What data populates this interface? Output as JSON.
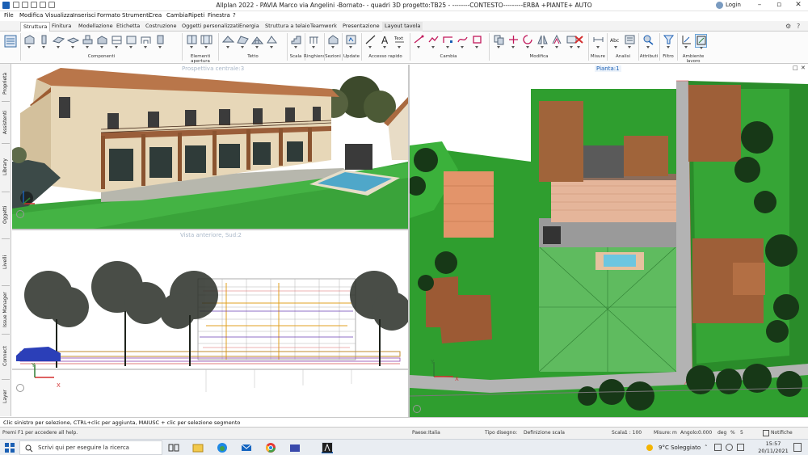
{
  "window": {
    "title": "Allplan 2022 - PAVIA Marco via Angelini -Bornato- - quadri 3D progetto:TB25 - --------CONTESTO---------ERBA +PIANTE+ AUTO",
    "login": "Login"
  },
  "menu": [
    "File",
    "Modifica",
    "Visualizza",
    "Inserisci",
    "Formato",
    "Strumenti",
    "Crea",
    "Cambia",
    "Ripeti",
    "Finestra",
    "?"
  ],
  "tabs": [
    "Struttura",
    "Finitura",
    "Modellazione",
    "Etichetta",
    "Costruzione",
    "Oggetti personalizzati",
    "Energia",
    "Struttura a telaio",
    "Teamwork",
    "Presentazione",
    "Layout tavola"
  ],
  "active_tab": "Struttura",
  "ribbon_groups": [
    "Componenti",
    "Elementi apertura",
    "Tetto",
    "Scala",
    "Ringhiera",
    "Sezioni",
    "Update",
    "Accesso rapido",
    "Cambia",
    "Modifica",
    "Misure",
    "Analisi",
    "Attributi",
    "Filtro",
    "Ambiente lavoro"
  ],
  "ribbon_labels": {
    "accesso_rapido_a": "A",
    "accesso_rapido_text": "Text",
    "analisi_abc": "Abc"
  },
  "side_tabs": [
    "Proprietà",
    "Assistenti",
    "Library",
    "Oggetti",
    "Livelli",
    "Issue Manager",
    "Connect",
    "Layer"
  ],
  "viewports": {
    "perspective_title": "Prospettiva centrale:3",
    "front_title": "Vista anteriore, Sud:2",
    "plan_title": "Pianta:1",
    "axis_x": "X",
    "axis_y": "Y",
    "axis_z": "Z"
  },
  "status": {
    "hint": "Clic sinistro per selezione, CTRL+clic per aggiunta, MAIUSC + clic per selezione segmento",
    "help": "Premi F1 per accedere all help.",
    "paese_label": "Paese:",
    "paese_value": "Italia",
    "tipo_label": "Tipo disegno:",
    "tipo_value": "Definizione scala",
    "scala_label": "Scala:",
    "scala_value": "1 : 100",
    "misure_label": "Misure:",
    "misure_value": "m",
    "angolo_label": "Angolo:",
    "angolo_value": "0.000",
    "deg_label": "deg",
    "deg_value": "%",
    "pct_value": "5",
    "notifiche": "Notifiche"
  },
  "taskbar": {
    "search_placeholder": "Scrivi qui per eseguire la ricerca",
    "weather": "9°C Soleggiato",
    "time": "15:57",
    "date": "20/11/2021"
  },
  "colors": {
    "accent": "#1a5fb4",
    "grass": "#2f9e2f",
    "roof": "#b5703f",
    "sky": "#ffffff"
  }
}
